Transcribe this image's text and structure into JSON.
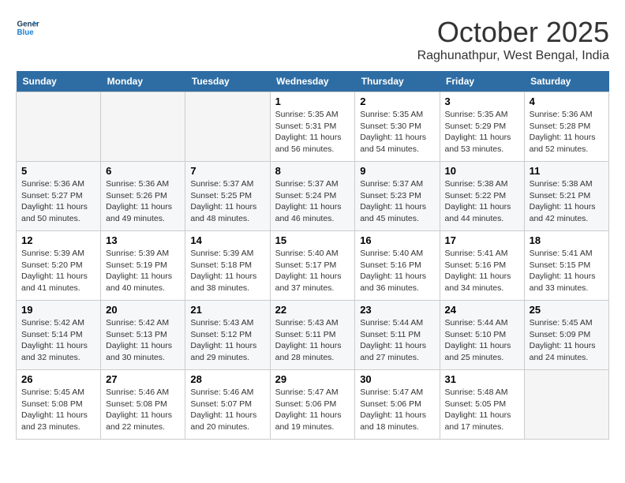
{
  "logo": {
    "line1": "General",
    "line2": "Blue"
  },
  "header": {
    "month": "October 2025",
    "location": "Raghunathpur, West Bengal, India"
  },
  "weekdays": [
    "Sunday",
    "Monday",
    "Tuesday",
    "Wednesday",
    "Thursday",
    "Friday",
    "Saturday"
  ],
  "weeks": [
    [
      {
        "day": "",
        "sunrise": "",
        "sunset": "",
        "daylight": ""
      },
      {
        "day": "",
        "sunrise": "",
        "sunset": "",
        "daylight": ""
      },
      {
        "day": "",
        "sunrise": "",
        "sunset": "",
        "daylight": ""
      },
      {
        "day": "1",
        "sunrise": "Sunrise: 5:35 AM",
        "sunset": "Sunset: 5:31 PM",
        "daylight": "Daylight: 11 hours and 56 minutes."
      },
      {
        "day": "2",
        "sunrise": "Sunrise: 5:35 AM",
        "sunset": "Sunset: 5:30 PM",
        "daylight": "Daylight: 11 hours and 54 minutes."
      },
      {
        "day": "3",
        "sunrise": "Sunrise: 5:35 AM",
        "sunset": "Sunset: 5:29 PM",
        "daylight": "Daylight: 11 hours and 53 minutes."
      },
      {
        "day": "4",
        "sunrise": "Sunrise: 5:36 AM",
        "sunset": "Sunset: 5:28 PM",
        "daylight": "Daylight: 11 hours and 52 minutes."
      }
    ],
    [
      {
        "day": "5",
        "sunrise": "Sunrise: 5:36 AM",
        "sunset": "Sunset: 5:27 PM",
        "daylight": "Daylight: 11 hours and 50 minutes."
      },
      {
        "day": "6",
        "sunrise": "Sunrise: 5:36 AM",
        "sunset": "Sunset: 5:26 PM",
        "daylight": "Daylight: 11 hours and 49 minutes."
      },
      {
        "day": "7",
        "sunrise": "Sunrise: 5:37 AM",
        "sunset": "Sunset: 5:25 PM",
        "daylight": "Daylight: 11 hours and 48 minutes."
      },
      {
        "day": "8",
        "sunrise": "Sunrise: 5:37 AM",
        "sunset": "Sunset: 5:24 PM",
        "daylight": "Daylight: 11 hours and 46 minutes."
      },
      {
        "day": "9",
        "sunrise": "Sunrise: 5:37 AM",
        "sunset": "Sunset: 5:23 PM",
        "daylight": "Daylight: 11 hours and 45 minutes."
      },
      {
        "day": "10",
        "sunrise": "Sunrise: 5:38 AM",
        "sunset": "Sunset: 5:22 PM",
        "daylight": "Daylight: 11 hours and 44 minutes."
      },
      {
        "day": "11",
        "sunrise": "Sunrise: 5:38 AM",
        "sunset": "Sunset: 5:21 PM",
        "daylight": "Daylight: 11 hours and 42 minutes."
      }
    ],
    [
      {
        "day": "12",
        "sunrise": "Sunrise: 5:39 AM",
        "sunset": "Sunset: 5:20 PM",
        "daylight": "Daylight: 11 hours and 41 minutes."
      },
      {
        "day": "13",
        "sunrise": "Sunrise: 5:39 AM",
        "sunset": "Sunset: 5:19 PM",
        "daylight": "Daylight: 11 hours and 40 minutes."
      },
      {
        "day": "14",
        "sunrise": "Sunrise: 5:39 AM",
        "sunset": "Sunset: 5:18 PM",
        "daylight": "Daylight: 11 hours and 38 minutes."
      },
      {
        "day": "15",
        "sunrise": "Sunrise: 5:40 AM",
        "sunset": "Sunset: 5:17 PM",
        "daylight": "Daylight: 11 hours and 37 minutes."
      },
      {
        "day": "16",
        "sunrise": "Sunrise: 5:40 AM",
        "sunset": "Sunset: 5:16 PM",
        "daylight": "Daylight: 11 hours and 36 minutes."
      },
      {
        "day": "17",
        "sunrise": "Sunrise: 5:41 AM",
        "sunset": "Sunset: 5:16 PM",
        "daylight": "Daylight: 11 hours and 34 minutes."
      },
      {
        "day": "18",
        "sunrise": "Sunrise: 5:41 AM",
        "sunset": "Sunset: 5:15 PM",
        "daylight": "Daylight: 11 hours and 33 minutes."
      }
    ],
    [
      {
        "day": "19",
        "sunrise": "Sunrise: 5:42 AM",
        "sunset": "Sunset: 5:14 PM",
        "daylight": "Daylight: 11 hours and 32 minutes."
      },
      {
        "day": "20",
        "sunrise": "Sunrise: 5:42 AM",
        "sunset": "Sunset: 5:13 PM",
        "daylight": "Daylight: 11 hours and 30 minutes."
      },
      {
        "day": "21",
        "sunrise": "Sunrise: 5:43 AM",
        "sunset": "Sunset: 5:12 PM",
        "daylight": "Daylight: 11 hours and 29 minutes."
      },
      {
        "day": "22",
        "sunrise": "Sunrise: 5:43 AM",
        "sunset": "Sunset: 5:11 PM",
        "daylight": "Daylight: 11 hours and 28 minutes."
      },
      {
        "day": "23",
        "sunrise": "Sunrise: 5:44 AM",
        "sunset": "Sunset: 5:11 PM",
        "daylight": "Daylight: 11 hours and 27 minutes."
      },
      {
        "day": "24",
        "sunrise": "Sunrise: 5:44 AM",
        "sunset": "Sunset: 5:10 PM",
        "daylight": "Daylight: 11 hours and 25 minutes."
      },
      {
        "day": "25",
        "sunrise": "Sunrise: 5:45 AM",
        "sunset": "Sunset: 5:09 PM",
        "daylight": "Daylight: 11 hours and 24 minutes."
      }
    ],
    [
      {
        "day": "26",
        "sunrise": "Sunrise: 5:45 AM",
        "sunset": "Sunset: 5:08 PM",
        "daylight": "Daylight: 11 hours and 23 minutes."
      },
      {
        "day": "27",
        "sunrise": "Sunrise: 5:46 AM",
        "sunset": "Sunset: 5:08 PM",
        "daylight": "Daylight: 11 hours and 22 minutes."
      },
      {
        "day": "28",
        "sunrise": "Sunrise: 5:46 AM",
        "sunset": "Sunset: 5:07 PM",
        "daylight": "Daylight: 11 hours and 20 minutes."
      },
      {
        "day": "29",
        "sunrise": "Sunrise: 5:47 AM",
        "sunset": "Sunset: 5:06 PM",
        "daylight": "Daylight: 11 hours and 19 minutes."
      },
      {
        "day": "30",
        "sunrise": "Sunrise: 5:47 AM",
        "sunset": "Sunset: 5:06 PM",
        "daylight": "Daylight: 11 hours and 18 minutes."
      },
      {
        "day": "31",
        "sunrise": "Sunrise: 5:48 AM",
        "sunset": "Sunset: 5:05 PM",
        "daylight": "Daylight: 11 hours and 17 minutes."
      },
      {
        "day": "",
        "sunrise": "",
        "sunset": "",
        "daylight": ""
      }
    ]
  ]
}
